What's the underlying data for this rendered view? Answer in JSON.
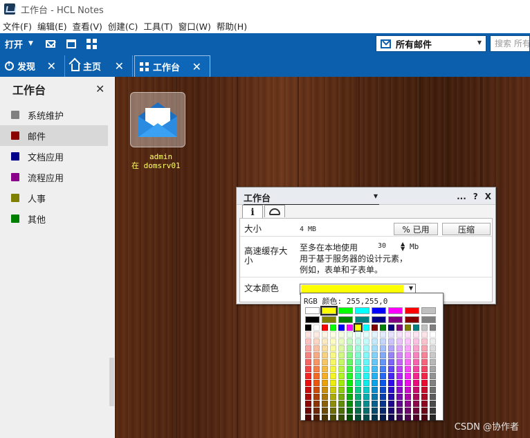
{
  "window": {
    "title": "工作台 - HCL Notes"
  },
  "menu": [
    "文件(F)",
    "编辑(E)",
    "查看(V)",
    "创建(C)",
    "工具(T)",
    "窗口(W)",
    "帮助(H)"
  ],
  "toolbar": {
    "open_label": "打开",
    "mailbox_label": "所有邮件",
    "search_placeholder": "搜索 所有邮件"
  },
  "tabs": [
    {
      "label": "发现",
      "icon": "discover-icon"
    },
    {
      "label": "主页",
      "icon": "home-icon"
    },
    {
      "label": "工作台",
      "icon": "workspace-grid-icon"
    }
  ],
  "sidebar": {
    "title": "工作台",
    "items": [
      {
        "label": "系统维护",
        "color": "#808080"
      },
      {
        "label": "邮件",
        "color": "#8b0000"
      },
      {
        "label": "文档应用",
        "color": "#00008b"
      },
      {
        "label": "流程应用",
        "color": "#8b008b"
      },
      {
        "label": "人事",
        "color": "#808000"
      },
      {
        "label": "其他",
        "color": "#008000"
      }
    ],
    "selected": "邮件"
  },
  "workspace_icon": {
    "icon": "mail-envelope-icon",
    "caption_line1": "admin",
    "caption_line2": "在 domsrv01"
  },
  "properties": {
    "title": "工作台",
    "header_buttons": [
      "...",
      "?",
      "X"
    ],
    "tabs": [
      "i",
      "bell"
    ],
    "size_label": "大小",
    "size_value": "4 MB",
    "percent_used_button": "% 已用",
    "compress_button": "压缩",
    "cache_label": "高速缓存大小",
    "cache_desc_prefix": "至多在本地使用",
    "cache_value": "30",
    "cache_unit": "Mb",
    "cache_desc_line2": "用于基于服务器的设计元素，",
    "cache_desc_line3": "例如，表单和子表单。",
    "text_color_label": "文本颜色",
    "text_color_value": "#ffff00"
  },
  "palette": {
    "rgb_label": "RGB 颜色: 255,255,0",
    "basic_colors": [
      "#ffffff",
      "#ffff00",
      "#00ff00",
      "#00ffff",
      "#0000ff",
      "#ff00ff",
      "#ff0000",
      "#c0c0c0",
      "#000000",
      "#808000",
      "#008000",
      "#008080",
      "#000080",
      "#800080",
      "#800000",
      "#808080"
    ],
    "selected_color": "#ffff00"
  },
  "watermark": "CSDN @协作者"
}
